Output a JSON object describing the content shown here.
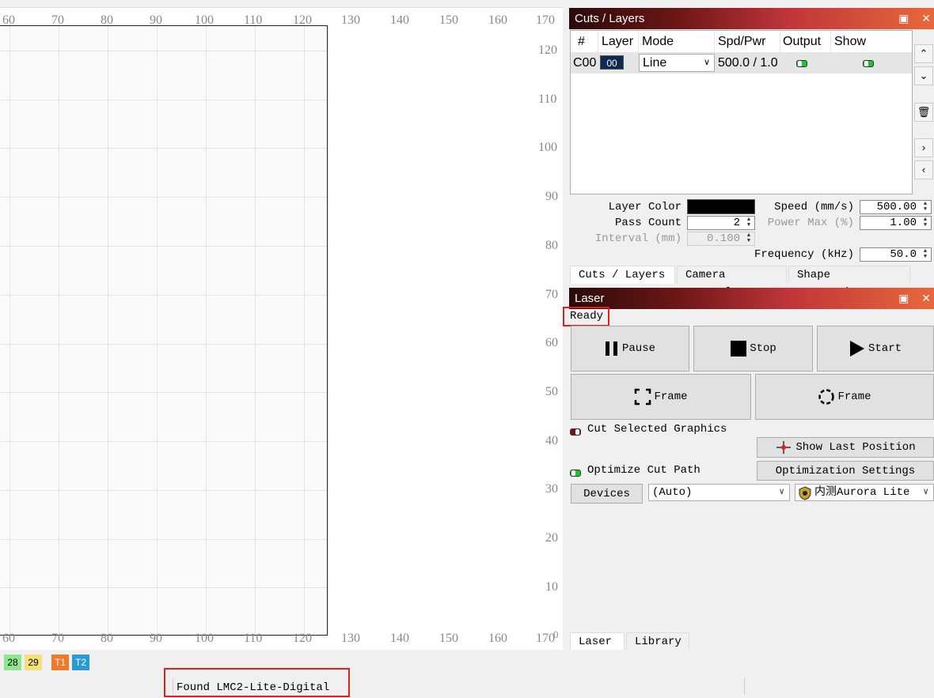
{
  "canvas": {
    "top_ticks": [
      "60",
      "70",
      "80",
      "90",
      "100",
      "110",
      "120",
      "130",
      "140",
      "150",
      "160",
      "170"
    ],
    "bottom_ticks": [
      "60",
      "70",
      "80",
      "90",
      "100",
      "110",
      "120",
      "130",
      "140",
      "150",
      "160",
      "170"
    ],
    "corner_tick": "0",
    "right_ticks": [
      "120",
      "110",
      "100",
      "90",
      "80",
      "70",
      "60",
      "50",
      "40",
      "30",
      "20",
      "10"
    ]
  },
  "cuts_panel": {
    "title": "Cuts / Layers",
    "columns": [
      "#",
      "Layer",
      "Mode",
      "Spd/Pwr",
      "Output",
      "Show"
    ],
    "rows": [
      {
        "num": "C00",
        "layer": "00",
        "mode": "Line",
        "spd_pwr": "500.0 / 1.0"
      }
    ],
    "layer_color_label": "Layer Color",
    "layer_color": "#000000",
    "pass_count_label": "Pass Count",
    "pass_count": "2",
    "interval_label": "Interval (mm)",
    "interval": "0.100",
    "speed_label": "Speed (mm/s)",
    "speed": "500.00",
    "power_max_label": "Power Max (%)",
    "power_max": "1.00",
    "frequency_label": "Frequency (kHz)",
    "frequency": "50.0",
    "tabs": [
      "Cuts / Layers",
      "Camera Control",
      "Shape Properties"
    ]
  },
  "laser_panel": {
    "title": "Laser",
    "status": "Ready",
    "pause_label": "Pause",
    "stop_label": "Stop",
    "start_label": "Start",
    "frame_label": "Frame",
    "circle_frame_label": "Frame",
    "cut_selected_label": "Cut Selected Graphics",
    "show_last_position_label": "Show Last Position",
    "optimize_cut_path_label": "Optimize Cut Path",
    "optimization_settings_label": "Optimization Settings",
    "devices_label": "Devices",
    "port_value": "(Auto)",
    "device_value": "内测Aurora Lite",
    "tabs": [
      "Laser",
      "Library"
    ]
  },
  "palette": {
    "chips": [
      {
        "label": "28",
        "color": "#8ee68e"
      },
      {
        "label": "29",
        "color": "#f7e07a"
      },
      {
        "label": "T1",
        "color": "#f07a2a"
      },
      {
        "label": "T2",
        "color": "#2a9ad6"
      }
    ]
  },
  "status_bar": {
    "message": "Found LMC2-Lite-Digital"
  },
  "colors": {
    "highlight": "#e0201b",
    "title_gradient_start": "#2b0a0a",
    "title_gradient_end": "#e8683a"
  }
}
